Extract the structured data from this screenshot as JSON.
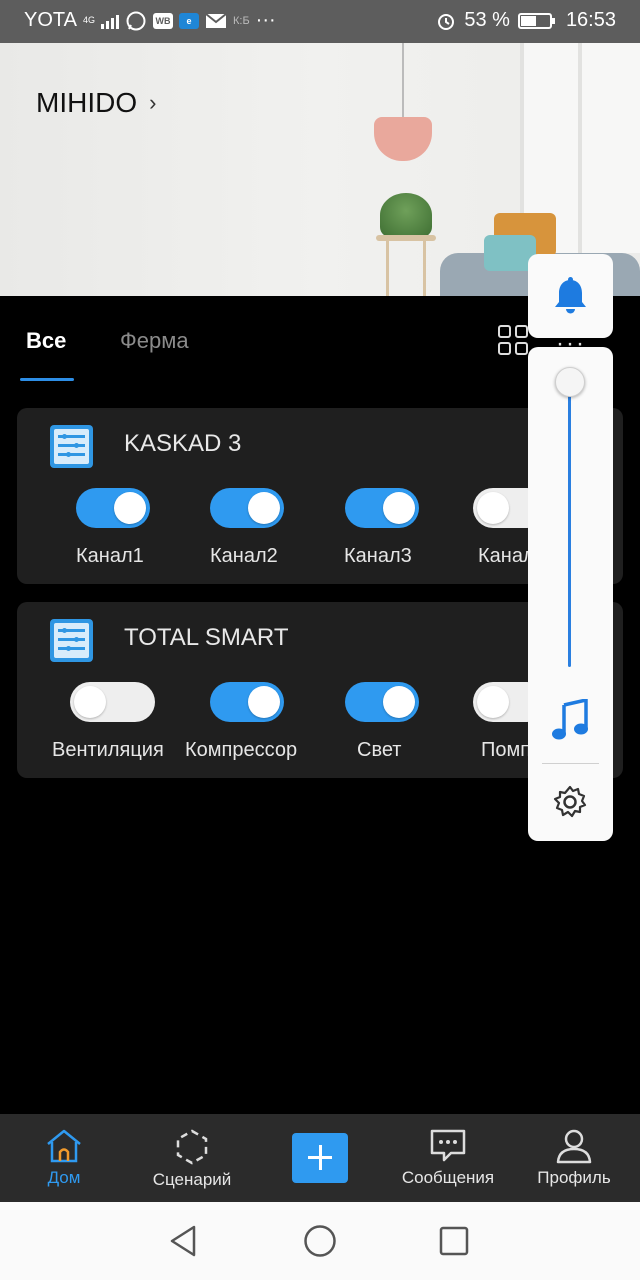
{
  "status_bar": {
    "carrier": "YOTA",
    "network": "4G",
    "apps": [
      "whatsapp-icon",
      "wb-icon",
      "edge-icon",
      "mail-icon",
      "kb-icon"
    ],
    "app_labels": {
      "wb": "WB",
      "edge": "e",
      "kb": "К:Б"
    },
    "more": "···",
    "battery": "53 %",
    "battery_level": 0.53,
    "time": "16:53"
  },
  "header": {
    "home_name": "MIHIDO",
    "chevron": "›"
  },
  "tabs": [
    {
      "label": "Все",
      "active": true
    },
    {
      "label": "Ферма",
      "active": false
    }
  ],
  "toolbar": {
    "more": "···"
  },
  "devices": [
    {
      "name": "KASKAD 3",
      "channels": [
        {
          "label": "Канал1",
          "on": true
        },
        {
          "label": "Канал2",
          "on": true
        },
        {
          "label": "Канал3",
          "on": true
        },
        {
          "label": "Канал4",
          "on": false
        }
      ]
    },
    {
      "name": "TOTAL SMART",
      "channels": [
        {
          "label": "Вентиляция",
          "on": false
        },
        {
          "label": "Компрессор",
          "on": true
        },
        {
          "label": "Свет",
          "on": true
        },
        {
          "label": "Помпа",
          "on": false
        }
      ]
    }
  ],
  "volume_panel": {
    "level": 1.0
  },
  "bottom_nav": {
    "home": "Дом",
    "scenes": "Сценарий",
    "messages": "Сообщения",
    "profile": "Профиль"
  },
  "colors": {
    "accent": "#2f9af0",
    "card": "#1f1f1f",
    "background": "#000000",
    "nav_bg": "#2b2b2b"
  }
}
